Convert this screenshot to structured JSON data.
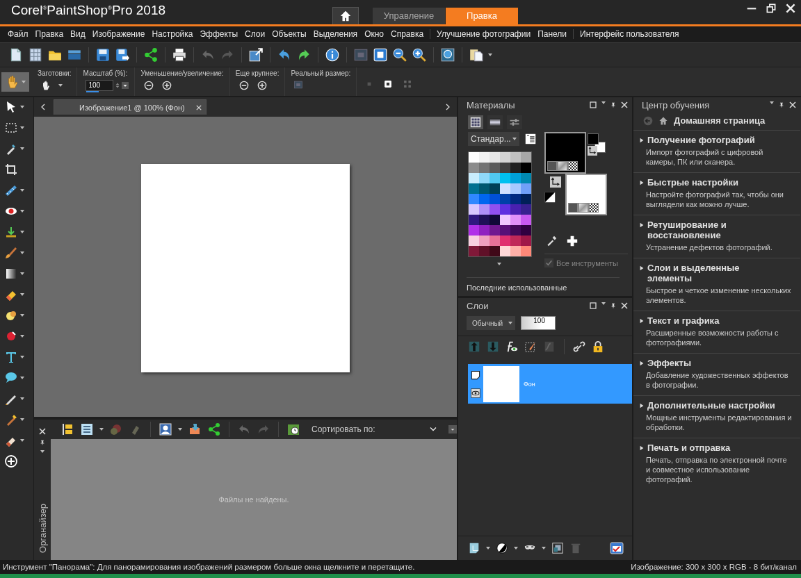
{
  "window": {
    "title": "Corel$^{®}$PaintShop$^{®}$Pro 2018"
  },
  "workspace_tabs": [
    {
      "label": "Управление",
      "selected": false
    },
    {
      "label": "Правка",
      "selected": true
    }
  ],
  "menu": [
    [
      "Файл",
      "Правка",
      "Вид",
      "Изображение",
      "Настройка",
      "Эффекты",
      "Слои",
      "Объекты",
      "Выделения",
      "Окно",
      "Справка"
    ],
    [
      "Улучшение фотографии",
      "Панели"
    ],
    [
      "Интерфейс пользователя"
    ]
  ],
  "tools": [
    {
      "kind": "pick",
      "selected": false
    },
    {
      "kind": "selection",
      "selected": false
    },
    {
      "kind": "dropper",
      "selected": false
    },
    {
      "kind": "crop",
      "selected": false
    },
    {
      "kind": "straighten",
      "selected": false
    },
    {
      "kind": "redeye",
      "selected": false
    },
    {
      "kind": "clone",
      "selected": false
    },
    {
      "kind": "brush",
      "selected": false
    },
    {
      "kind": "gradient",
      "selected": false
    },
    {
      "kind": "eraser",
      "selected": false
    },
    {
      "kind": "dodge",
      "selected": false
    },
    {
      "kind": "fill",
      "selected": false
    },
    {
      "kind": "text",
      "selected": false
    },
    {
      "kind": "shape",
      "selected": false
    },
    {
      "kind": "pen",
      "selected": false
    },
    {
      "kind": "warp",
      "selected": false
    },
    {
      "kind": "smudge",
      "selected": false
    },
    {
      "kind": "add",
      "selected": false
    }
  ],
  "pan_tool": {
    "selected": true
  },
  "tool_options": {
    "presets_label": "Заготовки:",
    "zoom_label": "Масштаб (%):",
    "zoom_value": "100",
    "zoom_slider": {
      "level": 0.45
    },
    "zoom_in_out_label": "Уменьшение/увеличение:",
    "zoom_more_label": "Еще крупнее:",
    "actual_size_label": "Реальный размер:"
  },
  "document_tabs": [
    {
      "label": "Изображение1 @ 100% (Фон)",
      "selected": true
    }
  ],
  "organizer": {
    "title": "Органайзер",
    "sort_label": "Сортировать по:",
    "empty_message": "Файлы не найдены."
  },
  "materials": {
    "title": "Материалы",
    "palette": "Стандар...",
    "swatches": [
      {
        "color": "#ffffff"
      },
      {
        "color": "#f2f2f2"
      },
      {
        "color": "#e6e6e6"
      },
      {
        "color": "#d4d4d4"
      },
      {
        "color": "#c0c0c0"
      },
      {
        "color": "#a8a8a8"
      },
      {
        "color": "#8c8c8c"
      },
      {
        "color": "#737373"
      },
      {
        "color": "#5a5a5a"
      },
      {
        "color": "#404040"
      },
      {
        "color": "#202020"
      },
      {
        "color": "#000000"
      },
      {
        "color": "#c8ecfc"
      },
      {
        "color": "#8fd8f8"
      },
      {
        "color": "#50c8f0"
      },
      {
        "color": "#00c0f0"
      },
      {
        "color": "#00a0d8"
      },
      {
        "color": "#0088b0"
      },
      {
        "color": "#007090"
      },
      {
        "color": "#005870"
      },
      {
        "color": "#004058"
      },
      {
        "color": "#d0e0ff"
      },
      {
        "color": "#a8c8ff"
      },
      {
        "color": "#70a0f8"
      },
      {
        "color": "#3088ff"
      },
      {
        "color": "#0066f0"
      },
      {
        "color": "#0050d8"
      },
      {
        "color": "#0040a8"
      },
      {
        "color": "#002880"
      },
      {
        "color": "#002058"
      },
      {
        "color": "#d8c8ff"
      },
      {
        "color": "#b090f8"
      },
      {
        "color": "#9050f0"
      },
      {
        "color": "#6030e0"
      },
      {
        "color": "#4820b0"
      },
      {
        "color": "#382090"
      },
      {
        "color": "#301880"
      },
      {
        "color": "#201058"
      },
      {
        "color": "#100838"
      },
      {
        "color": "#f0c8ff"
      },
      {
        "color": "#e090f8"
      },
      {
        "color": "#c858f0"
      },
      {
        "color": "#b030e8"
      },
      {
        "color": "#9020c0"
      },
      {
        "color": "#701890"
      },
      {
        "color": "#581078"
      },
      {
        "color": "#400858"
      },
      {
        "color": "#300040"
      },
      {
        "color": "#f8d0e0"
      },
      {
        "color": "#f0a0c0"
      },
      {
        "color": "#e87098"
      },
      {
        "color": "#e03070"
      },
      {
        "color": "#c02858"
      },
      {
        "color": "#a01848"
      },
      {
        "color": "#801838"
      },
      {
        "color": "#601028"
      },
      {
        "color": "#400818"
      },
      {
        "color": "#ffd8d8"
      },
      {
        "color": "#ffb0a8"
      },
      {
        "color": "#ff8878"
      }
    ],
    "foreground": {
      "color": "#000000"
    },
    "background": {
      "color": "#ffffff"
    },
    "all_tools": {
      "label": "Все инструменты",
      "checked": true
    },
    "recent_label": "Последние использованные"
  },
  "layers": {
    "title": "Слои",
    "blend_mode": "Обычный",
    "opacity": "100",
    "items": [
      {
        "name": "Фон",
        "selected": true
      }
    ]
  },
  "learning_center": {
    "title": "Центр обучения",
    "home": "Домашняя страница",
    "sections": [
      {
        "title": "Получение фотографий",
        "description": "Импорт фотографий с цифровой камеры, ПК или сканера."
      },
      {
        "title": "Быстрые настройки",
        "description": "Настройте фотографий так, чтобы они выглядели как можно лучше."
      },
      {
        "title": "Ретуширование и восстановление",
        "description": "Устранение дефектов фотографий."
      },
      {
        "title": "Слои и выделенные элементы",
        "description": "Быстрое и четкое изменение нескольких элементов."
      },
      {
        "title": "Текст и графика",
        "description": "Расширенные возможности работы с фотографиями."
      },
      {
        "title": "Эффекты",
        "description": "Добавление художественных эффектов в фотографии."
      },
      {
        "title": "Дополнительные настройки",
        "description": "Мощные инструменты редактирования и обработки."
      },
      {
        "title": "Печать и отправка",
        "description": "Печать, отправка по электронной почте и совместное использование фотографий."
      }
    ]
  },
  "status_bar": {
    "message": "Инструмент \"Панорама\": Для панорамирования изображений размером больше окна щелкните и перетащите.",
    "image_info": "Изображение:  300 x 300 x RGB - 8 бит/канал"
  }
}
